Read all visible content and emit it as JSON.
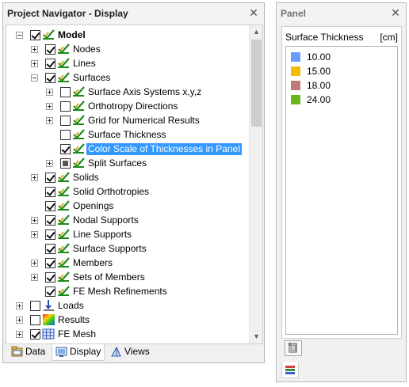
{
  "navigator": {
    "title": "Project Navigator - Display",
    "close_glyph": "✕",
    "tree": [
      {
        "label": "Model",
        "level": 0,
        "expander": "minus",
        "checkbox": "checked",
        "icon": "model-check-icon",
        "bold": true
      },
      {
        "label": "Nodes",
        "level": 1,
        "expander": "plus",
        "checkbox": "checked",
        "icon": "check-icon"
      },
      {
        "label": "Lines",
        "level": 1,
        "expander": "plus",
        "checkbox": "checked",
        "icon": "check-icon"
      },
      {
        "label": "Surfaces",
        "level": 1,
        "expander": "minus",
        "checkbox": "checked",
        "icon": "check-icon"
      },
      {
        "label": "Surface Axis Systems x,y,z",
        "level": 2,
        "expander": "plus",
        "checkbox": "unchecked",
        "icon": "check-icon"
      },
      {
        "label": "Orthotropy Directions",
        "level": 2,
        "expander": "plus",
        "checkbox": "unchecked",
        "icon": "check-icon"
      },
      {
        "label": "Grid for Numerical Results",
        "level": 2,
        "expander": "plus",
        "checkbox": "unchecked",
        "icon": "check-icon"
      },
      {
        "label": "Surface Thickness",
        "level": 2,
        "expander": "none",
        "checkbox": "unchecked",
        "icon": "check-icon"
      },
      {
        "label": "Color Scale of Thicknesses in Panel",
        "level": 2,
        "expander": "none",
        "checkbox": "checked",
        "icon": "check-icon",
        "selected": true
      },
      {
        "label": "Split Surfaces",
        "level": 2,
        "expander": "plus",
        "checkbox": "partial",
        "icon": "check-icon"
      },
      {
        "label": "Solids",
        "level": 1,
        "expander": "plus",
        "checkbox": "checked",
        "icon": "check-icon"
      },
      {
        "label": "Solid Orthotropies",
        "level": 1,
        "expander": "none",
        "checkbox": "checked",
        "icon": "check-icon"
      },
      {
        "label": "Openings",
        "level": 1,
        "expander": "none",
        "checkbox": "checked",
        "icon": "check-icon"
      },
      {
        "label": "Nodal Supports",
        "level": 1,
        "expander": "plus",
        "checkbox": "checked",
        "icon": "check-icon"
      },
      {
        "label": "Line Supports",
        "level": 1,
        "expander": "plus",
        "checkbox": "checked",
        "icon": "check-icon"
      },
      {
        "label": "Surface Supports",
        "level": 1,
        "expander": "none",
        "checkbox": "checked",
        "icon": "check-icon"
      },
      {
        "label": "Members",
        "level": 1,
        "expander": "plus",
        "checkbox": "checked",
        "icon": "check-icon"
      },
      {
        "label": "Sets of Members",
        "level": 1,
        "expander": "plus",
        "checkbox": "checked",
        "icon": "check-icon"
      },
      {
        "label": "FE Mesh Refinements",
        "level": 1,
        "expander": "none",
        "checkbox": "checked",
        "icon": "check-icon"
      },
      {
        "label": "Loads",
        "level": 0,
        "expander": "plus",
        "checkbox": "unchecked",
        "icon": "loads-icon"
      },
      {
        "label": "Results",
        "level": 0,
        "expander": "plus",
        "checkbox": "unchecked",
        "icon": "results-icon"
      },
      {
        "label": "FE Mesh",
        "level": 0,
        "expander": "plus",
        "checkbox": "checked",
        "icon": "fe-mesh-icon"
      }
    ],
    "tabs": [
      {
        "label": "Data",
        "icon": "data-icon",
        "active": false
      },
      {
        "label": "Display",
        "icon": "display-icon",
        "active": true
      },
      {
        "label": "Views",
        "icon": "views-icon",
        "active": false
      }
    ],
    "scroll_up_glyph": "▲",
    "scroll_down_glyph": "▼"
  },
  "panel": {
    "title": "Panel",
    "close_glyph": "✕",
    "header_label": "Surface Thickness",
    "unit": "[cm]",
    "legend": [
      {
        "value": "10.00",
        "color": "#6a9cff"
      },
      {
        "value": "15.00",
        "color": "#f2bd00"
      },
      {
        "value": "18.00",
        "color": "#c07a7a"
      },
      {
        "value": "24.00",
        "color": "#6bb51f"
      }
    ],
    "button_icon": "panel-settings-icon",
    "bottom_tab_icon": "color-scale-icon"
  }
}
